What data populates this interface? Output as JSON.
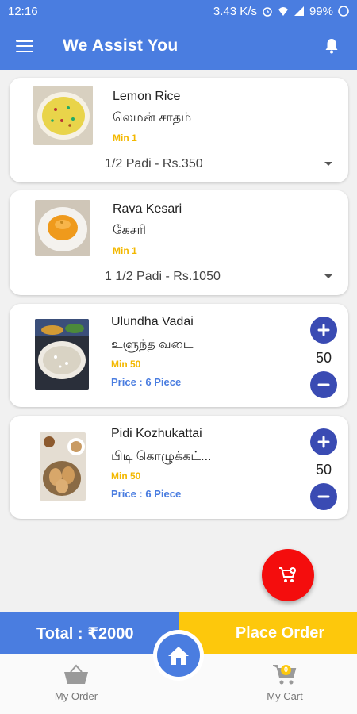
{
  "status_bar": {
    "time": "12:16",
    "network_speed": "3.43 K/s",
    "battery": "99%"
  },
  "app_bar": {
    "title": "We Assist You"
  },
  "items": [
    {
      "name": "Lemon Rice",
      "tamil": "லெமன் சாதம்",
      "min": "Min 1",
      "selected_option": "1/2 Padi - Rs.350"
    },
    {
      "name": "Rava Kesari",
      "tamil": "கேசரி",
      "min": "Min 1",
      "selected_option": "1 1/2 Padi - Rs.1050"
    },
    {
      "name": "Ulundha Vadai",
      "tamil": "உளுந்த வடை",
      "min": "Min 50",
      "price": "Price : 6  Piece",
      "quantity": "50"
    },
    {
      "name": "Pidi Kozhukattai",
      "tamil": "பிடி கொழுக்கட்...",
      "min": "Min 50",
      "price": "Price : 6  Piece",
      "quantity": "50"
    }
  ],
  "cart_bar": {
    "total": "Total : ₹2000",
    "place_order": "Place Order"
  },
  "nav": {
    "my_order": "My Order",
    "my_cart": "My Cart",
    "cart_badge": "0"
  },
  "colors": {
    "primary": "#4a7de0",
    "accent": "#fdc80c",
    "fab": "#f40d0d",
    "qty_button": "#3a4bb3"
  },
  "icons": [
    "menu-icon",
    "bell-icon",
    "plus-icon",
    "minus-icon",
    "add-cart-icon",
    "home-icon",
    "basket-icon",
    "cart-icon",
    "caret-down-icon"
  ]
}
